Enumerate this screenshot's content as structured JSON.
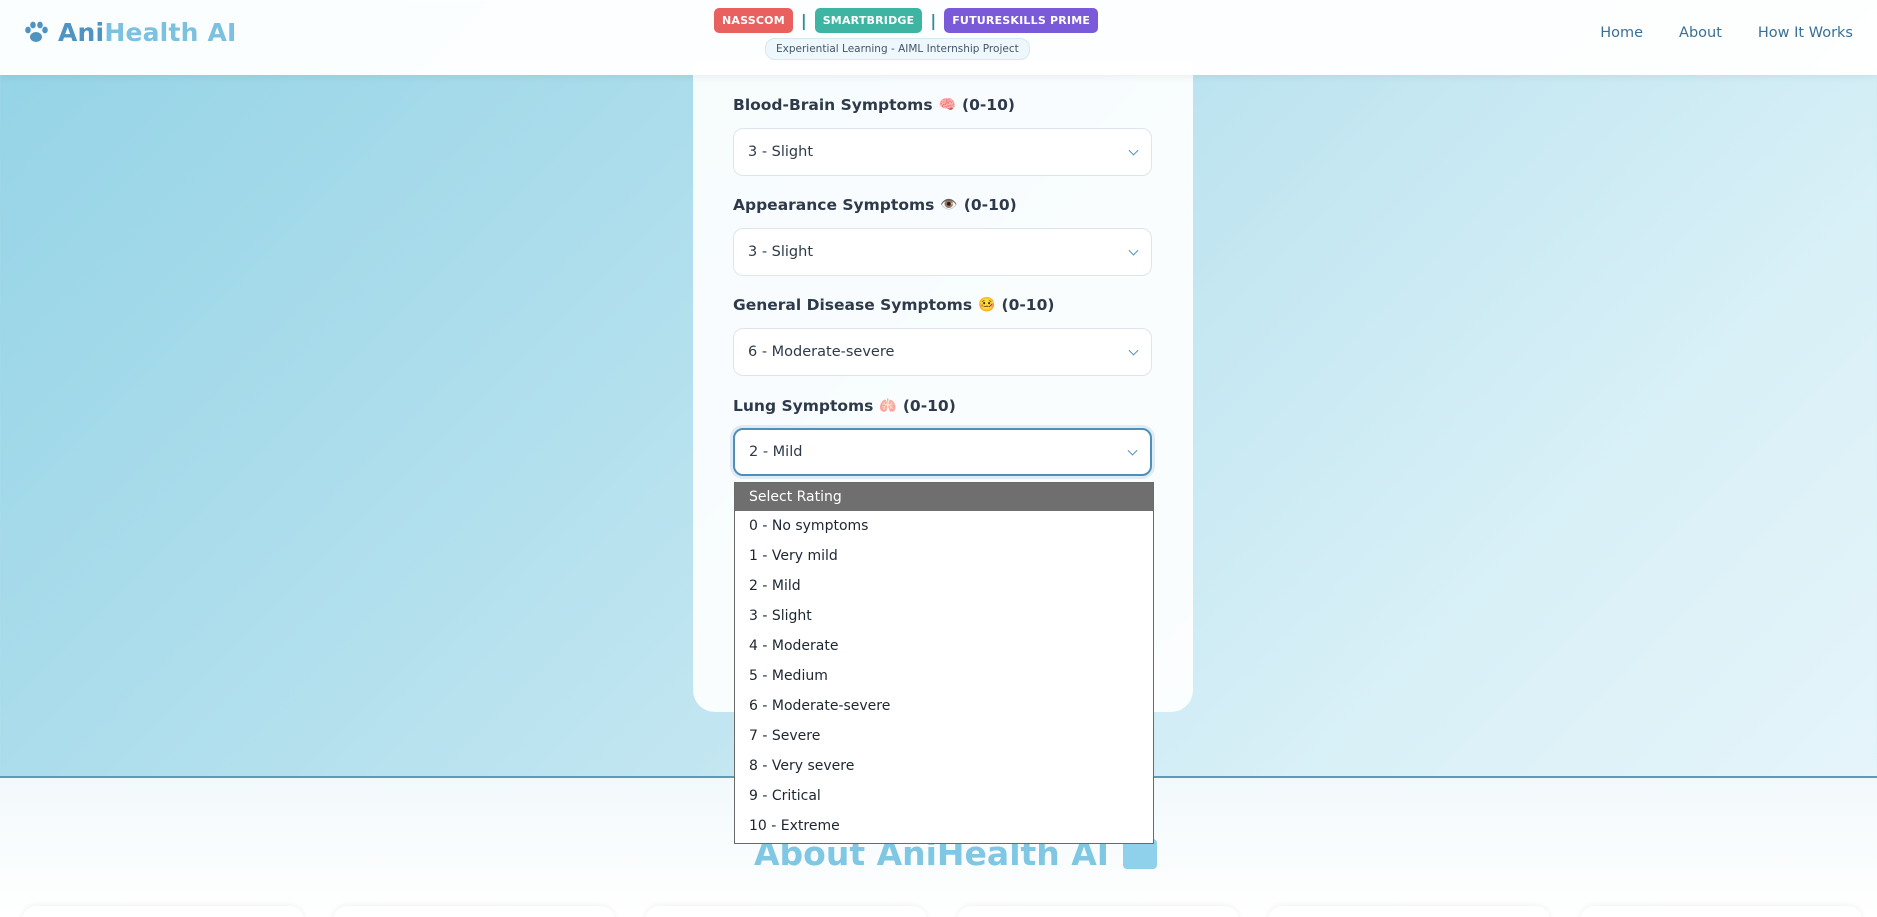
{
  "header": {
    "logo_ani": "Ani",
    "logo_rest": "Health AI",
    "badges": [
      "NASSCOM",
      "SMARTBRIDGE",
      "FUTURESKILLS PRIME"
    ],
    "separator": "|",
    "subtitle": "Experiential Learning - AIML Internship Project",
    "nav": [
      "Home",
      "About",
      "How It Works"
    ]
  },
  "form": {
    "fields": [
      {
        "label": "Blood-Brain Symptoms",
        "emoji": "🧠",
        "range": "(0-10)",
        "value": "3 - Slight"
      },
      {
        "label": "Appearance Symptoms",
        "emoji": "👁️",
        "range": "(0-10)",
        "value": "3 - Slight"
      },
      {
        "label": "General Disease Symptoms",
        "emoji": "🤒",
        "range": "(0-10)",
        "value": "6 - Moderate-severe"
      },
      {
        "label": "Lung Symptoms",
        "emoji": "🫁",
        "range": "(0-10)",
        "value": "2 - Mild"
      }
    ]
  },
  "dropdown": {
    "options": [
      "Select Rating",
      "0 - No symptoms",
      "1 - Very mild",
      "2 - Mild",
      "3 - Slight",
      "4 - Moderate",
      "5 - Medium",
      "6 - Moderate-severe",
      "7 - Severe",
      "8 - Very severe",
      "9 - Critical",
      "10 - Extreme"
    ],
    "highlighted": "Select Rating"
  },
  "about": {
    "title": "About AniHealth AI"
  },
  "colors": {
    "accent": "#4f8fb9",
    "nasscom": "#e8615f",
    "smartbridge": "#3db5a2",
    "futureskills": "#7a5ad8"
  }
}
